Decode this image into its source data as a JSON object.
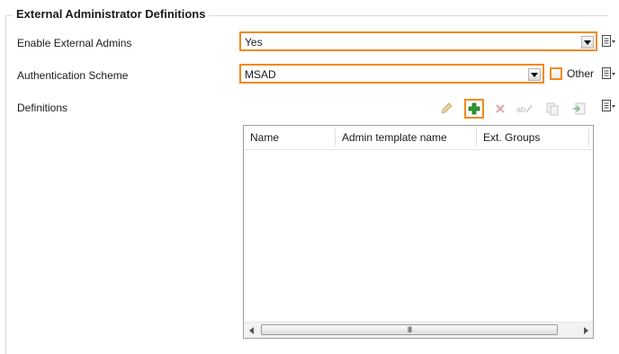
{
  "group": {
    "title": "External Administrator Definitions"
  },
  "enable_external_admins": {
    "label": "Enable External Admins",
    "value": "Yes"
  },
  "authentication_scheme": {
    "label": "Authentication Scheme",
    "value": "MSAD",
    "other_label": "Other"
  },
  "definitions": {
    "label": "Definitions",
    "toolbar": [
      "edit-icon",
      "add-icon",
      "delete-icon",
      "rename-icon",
      "copy-icon",
      "import-icon"
    ],
    "columns": [
      "Name",
      "Admin template name",
      "Ext. Groups"
    ],
    "rows": [],
    "scroll_thumb_grip": "III"
  },
  "colors": {
    "highlight": "#f08a1c",
    "add_green": "#2f9a2f",
    "delete_red": "#d94b4b"
  }
}
